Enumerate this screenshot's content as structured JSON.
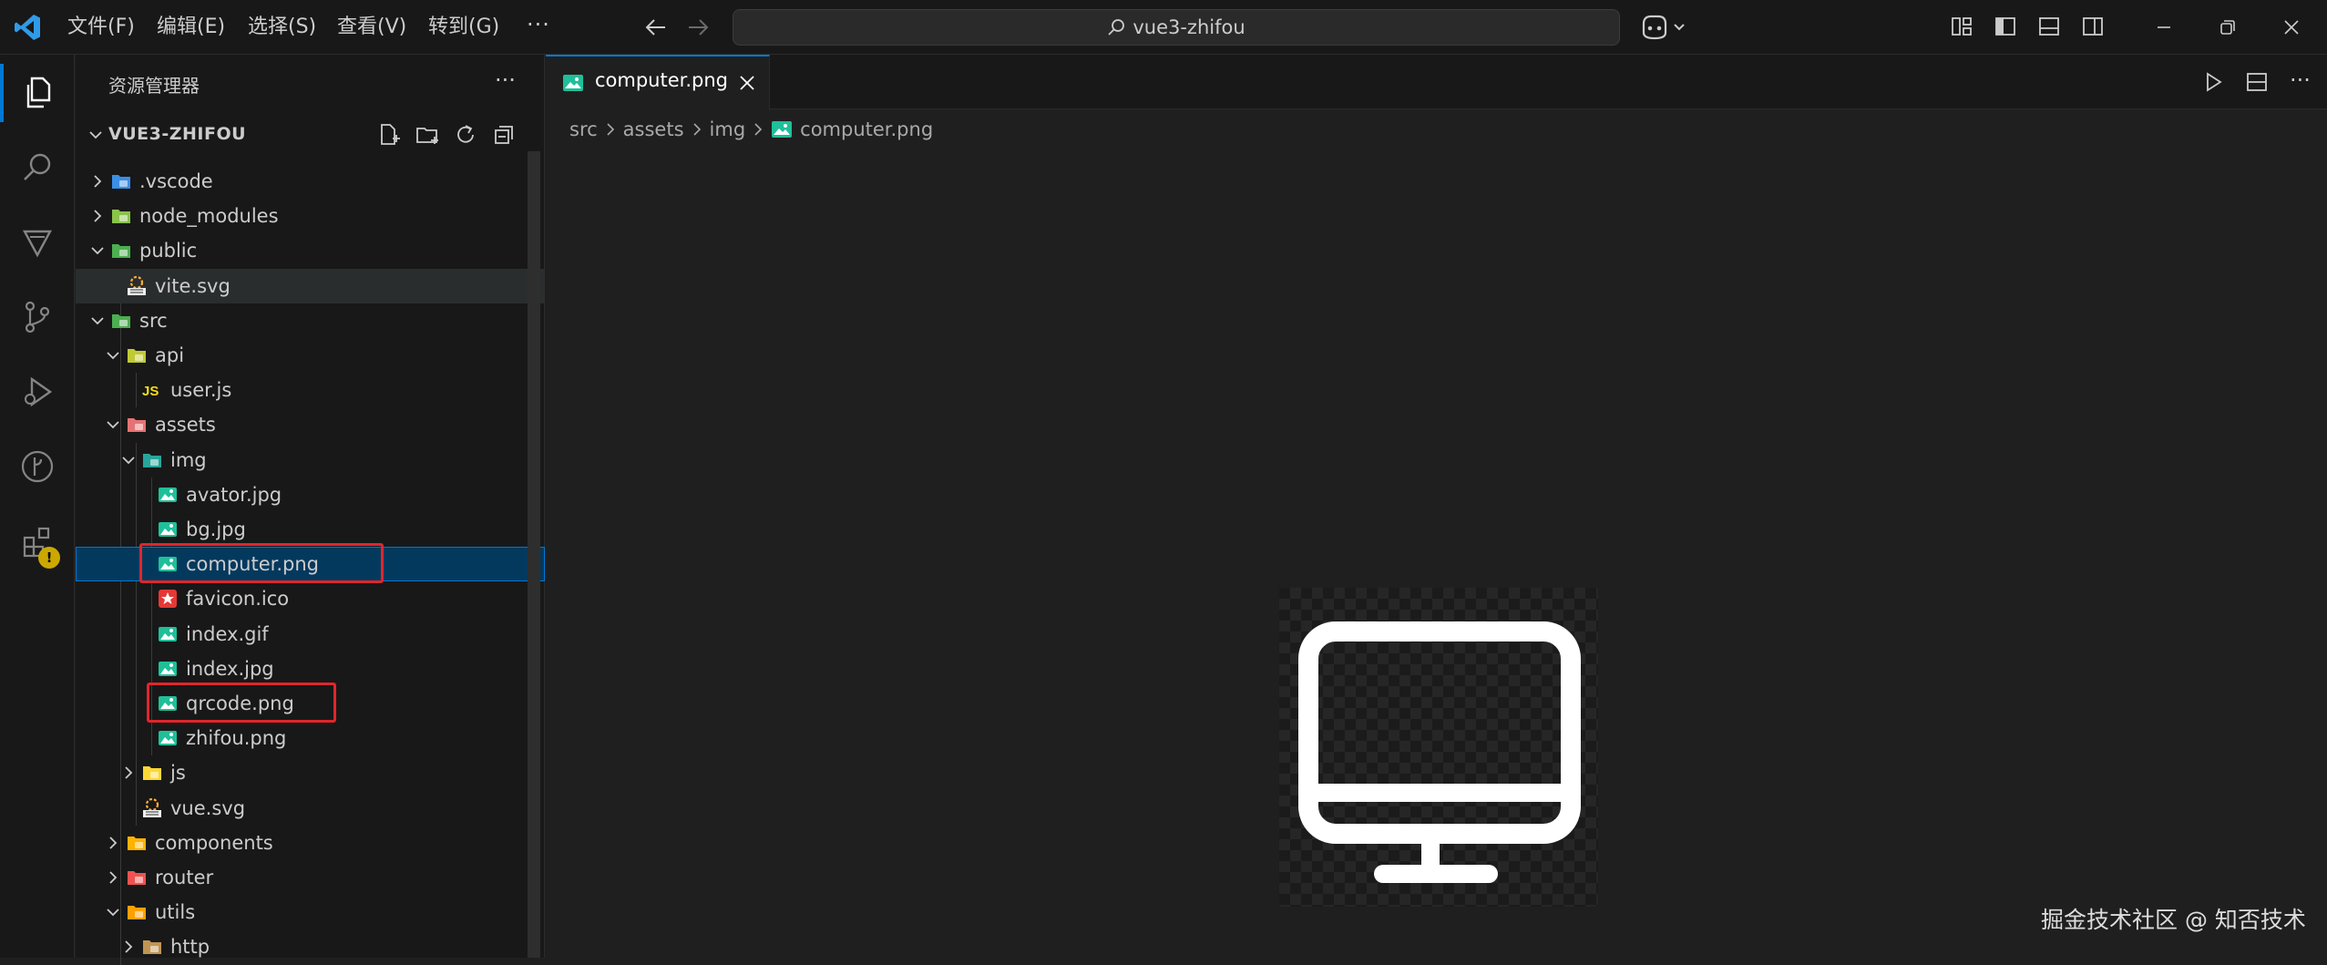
{
  "titlebar": {
    "menu": [
      "文件(F)",
      "编辑(E)",
      "选择(S)",
      "查看(V)",
      "转到(G)"
    ],
    "more": "···",
    "command_center": "vue3-zhifou"
  },
  "sidebar": {
    "title": "资源管理器",
    "more": "···",
    "project": "VUE3-ZHIFOU",
    "tree": [
      {
        "name": ".vscode",
        "icon": "folder-vscode-icon",
        "expanded": false
      },
      {
        "name": "node_modules",
        "icon": "folder-node-icon",
        "expanded": false
      },
      {
        "name": "public",
        "icon": "folder-public-icon",
        "expanded": true
      },
      {
        "name": "vite.svg",
        "icon": "svg-file-icon"
      },
      {
        "name": "src",
        "icon": "folder-src-icon",
        "expanded": true
      },
      {
        "name": "api",
        "icon": "folder-api-icon",
        "expanded": true
      },
      {
        "name": "user.js",
        "icon": "js-file-icon",
        "icon_text": "JS"
      },
      {
        "name": "assets",
        "icon": "folder-assets-icon",
        "expanded": true
      },
      {
        "name": "img",
        "icon": "folder-images-icon",
        "expanded": true
      },
      {
        "name": "avator.jpg",
        "icon": "image-file-icon"
      },
      {
        "name": "bg.jpg",
        "icon": "image-file-icon"
      },
      {
        "name": "computer.png",
        "icon": "image-file-icon",
        "selected": true
      },
      {
        "name": "favicon.ico",
        "icon": "favicon-file-icon"
      },
      {
        "name": "index.gif",
        "icon": "image-file-icon"
      },
      {
        "name": "index.jpg",
        "icon": "image-file-icon"
      },
      {
        "name": "qrcode.png",
        "icon": "image-file-icon"
      },
      {
        "name": "zhifou.png",
        "icon": "image-file-icon"
      },
      {
        "name": "js",
        "icon": "folder-js-icon",
        "expanded": false
      },
      {
        "name": "vue.svg",
        "icon": "svg-file-icon"
      },
      {
        "name": "components",
        "icon": "folder-components-icon",
        "expanded": false
      },
      {
        "name": "router",
        "icon": "folder-router-icon",
        "expanded": false
      },
      {
        "name": "utils",
        "icon": "folder-utils-icon",
        "expanded": true
      },
      {
        "name": "http",
        "icon": "folder-icon",
        "expanded": false
      }
    ]
  },
  "editor": {
    "tab": {
      "label": "computer.png",
      "icon": "image-file-icon"
    },
    "breadcrumb": [
      "src",
      "assets",
      "img",
      "computer.png"
    ]
  },
  "colors": {
    "accent": "#0078d4",
    "highlight_box": "#e0262b",
    "selection": "#04395e"
  },
  "watermark": "掘金技术社区 @ 知否技术"
}
